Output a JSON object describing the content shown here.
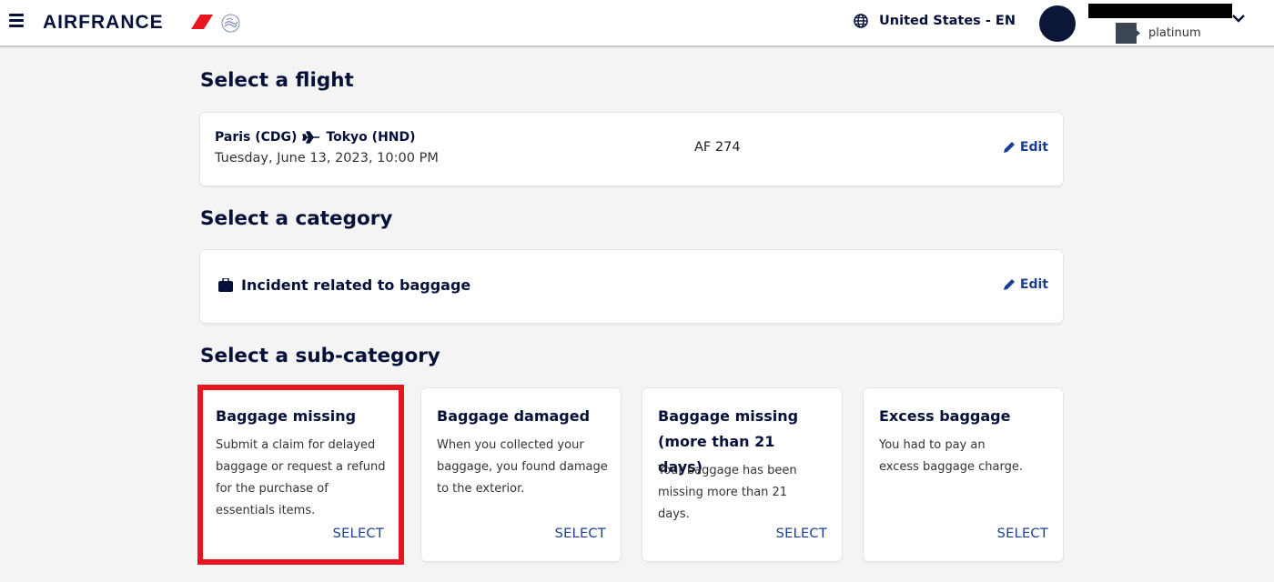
{
  "header": {
    "brand": "AIRFRANCE",
    "locale": "United States - EN",
    "user": {
      "tier": "platinum"
    }
  },
  "flight_section": {
    "title": "Select a flight",
    "origin": "Paris (CDG)",
    "destination": "Tokyo (HND)",
    "date": "Tuesday, June 13, 2023, 10:00 PM",
    "flight_number": "AF 274",
    "edit_label": "Edit"
  },
  "category_section": {
    "title": "Select a category",
    "selected_category": "Incident related to baggage",
    "edit_label": "Edit"
  },
  "subcategory_section": {
    "title": "Select a sub-category",
    "selected_index": 0,
    "items": [
      {
        "title": "Baggage missing",
        "description": "Submit a claim for delayed baggage or request a refund for the purchase of essentials items.",
        "action": "SELECT"
      },
      {
        "title": "Baggage damaged",
        "description": "When you collected your baggage, you found damage to the exterior.",
        "action": "SELECT"
      },
      {
        "title": "Baggage missing (more than 21 days)",
        "description": "Your baggage has been missing more than 21 days.",
        "action": "SELECT"
      },
      {
        "title": "Excess baggage",
        "description": "You had to pay an excess baggage charge.",
        "action": "SELECT"
      }
    ]
  },
  "colors": {
    "brand_navy": "#051039",
    "link_blue": "#1a3e95",
    "brand_red": "#e8141f",
    "highlight_red": "#e8141f"
  }
}
